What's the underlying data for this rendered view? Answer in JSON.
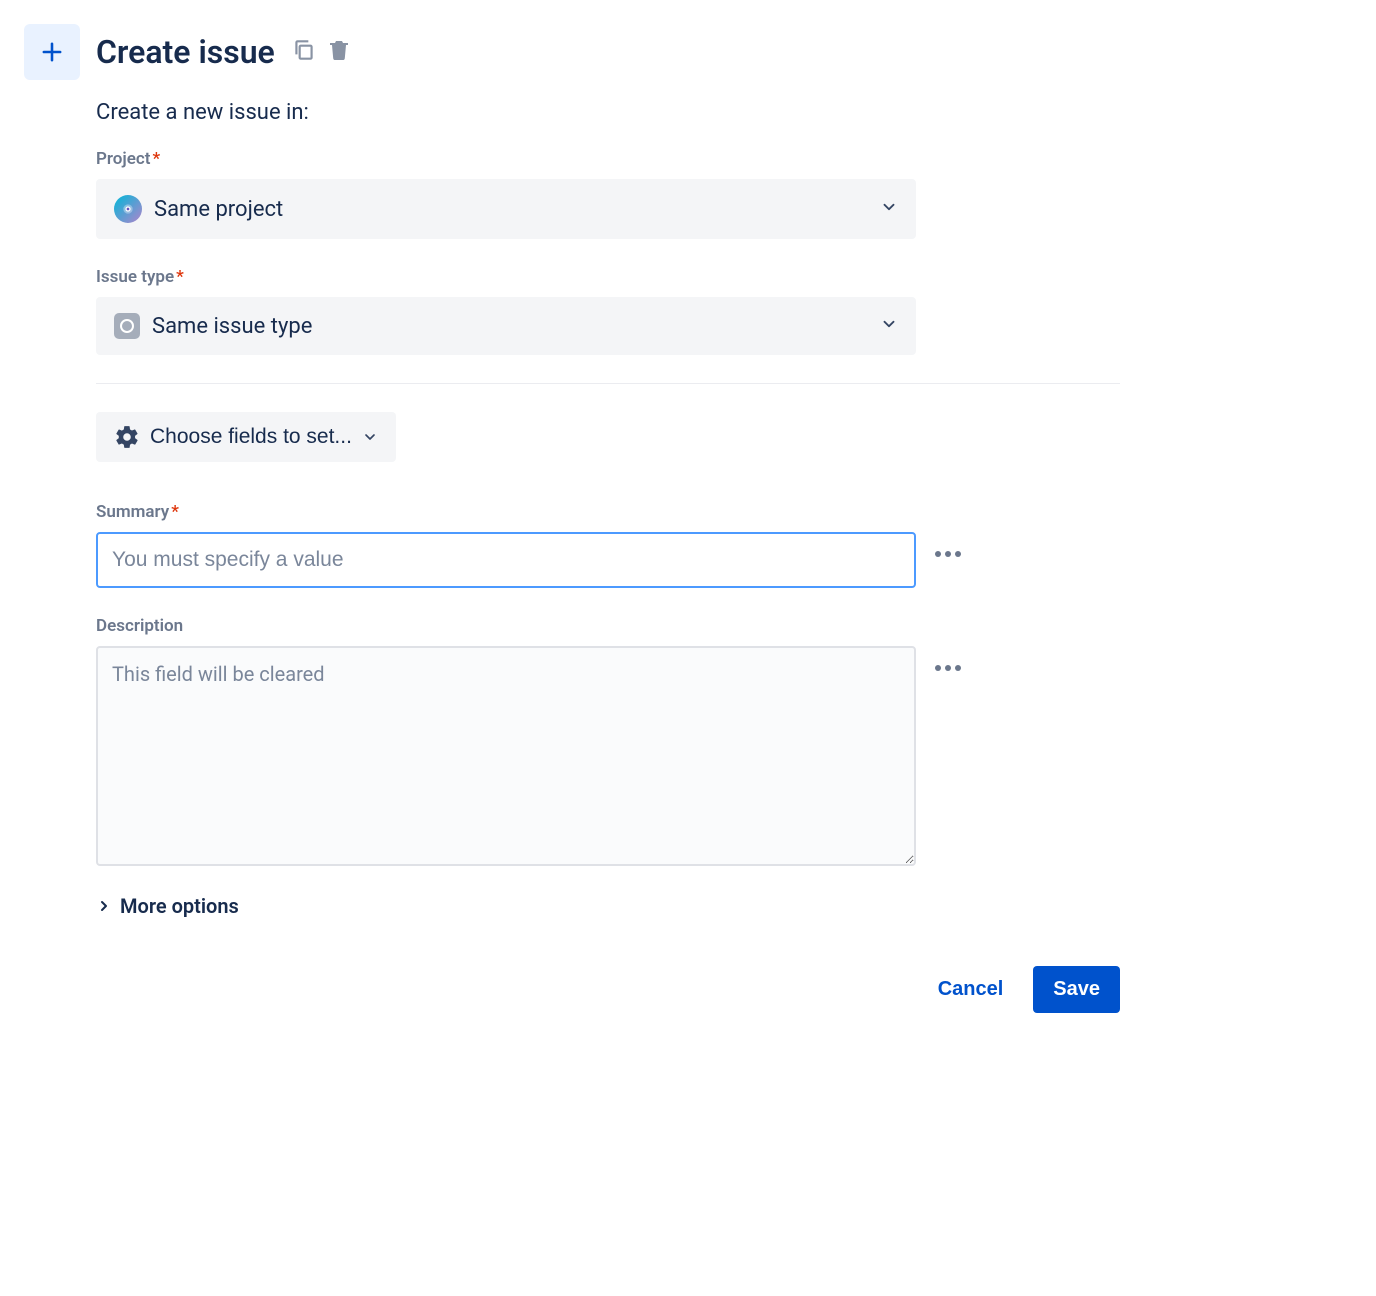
{
  "header": {
    "title": "Create issue"
  },
  "subtitle": "Create a new issue in:",
  "fields": {
    "project": {
      "label": "Project",
      "value": "Same project"
    },
    "issue_type": {
      "label": "Issue type",
      "value": "Same issue type"
    },
    "choose_fields_label": "Choose fields to set...",
    "summary": {
      "label": "Summary",
      "placeholder": "You must specify a value",
      "value": ""
    },
    "description": {
      "label": "Description",
      "placeholder": "This field will be cleared",
      "value": ""
    }
  },
  "more_options_label": "More options",
  "buttons": {
    "cancel": "Cancel",
    "save": "Save"
  }
}
